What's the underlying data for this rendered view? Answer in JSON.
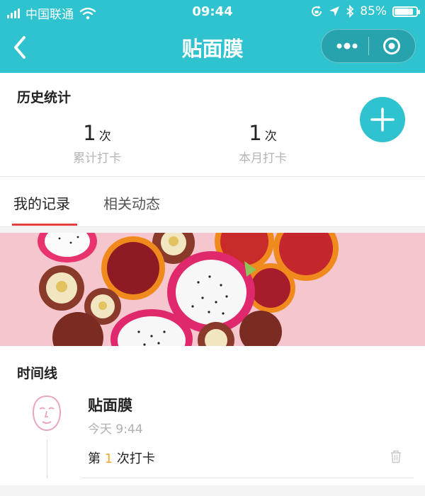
{
  "status_bar": {
    "carrier": "中国联通",
    "time": "09:44",
    "battery_percent": "85%",
    "battery_level": 0.85,
    "icons": [
      "signal-icon",
      "wifi-icon",
      "lock-rotation-icon",
      "location-icon",
      "bluetooth-icon",
      "battery-icon"
    ]
  },
  "nav": {
    "title": "贴面膜",
    "back_icon": "chevron-left-icon",
    "capsule_icons": [
      "more-dots-icon",
      "close-circle-icon"
    ]
  },
  "stats": {
    "title": "历史统计",
    "items": [
      {
        "value": "1",
        "unit": "次",
        "label": "累计打卡"
      },
      {
        "value": "1",
        "unit": "次",
        "label": "本月打卡"
      }
    ],
    "add_icon": "plus-icon"
  },
  "tabs": [
    {
      "label": "我的记录",
      "active": true
    },
    {
      "label": "相关动态",
      "active": false
    }
  ],
  "timeline": {
    "title": "时间线",
    "entry": {
      "icon": "face-mask-icon",
      "name": "贴面膜",
      "time": "今天 9:44",
      "checkin_prefix": "第 ",
      "checkin_count": "1",
      "checkin_suffix": " 次打卡",
      "delete_icon": "trash-icon"
    }
  },
  "colors": {
    "accent": "#2fc3cf",
    "tab_underline": "#e33d3d",
    "count_highlight": "#f0a830"
  }
}
